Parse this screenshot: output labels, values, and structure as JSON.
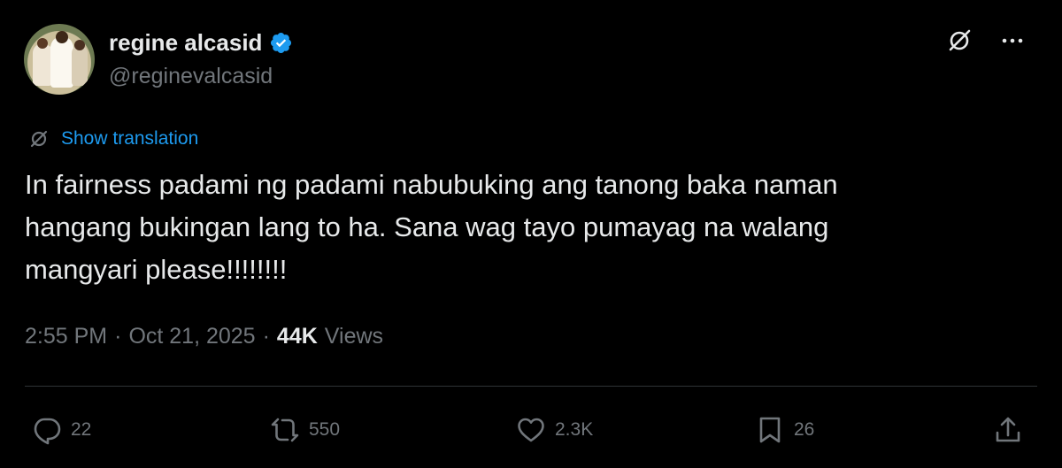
{
  "user": {
    "display_name": "regine alcasid",
    "handle": "@reginevalcasid",
    "verified": true
  },
  "translate": {
    "label": "Show translation"
  },
  "tweet": {
    "lines": [
      "In fairness padami ng padami nabubuking ang tanong baka naman",
      "hangang bukingan lang to ha. Sana wag tayo pumayag na walang",
      "mangyari please!!!!!!!!"
    ]
  },
  "meta": {
    "time": "2:55 PM",
    "separator": "·",
    "date": "Oct 21, 2025",
    "views_count": "44K",
    "views_label": "Views"
  },
  "actions": {
    "replies": "22",
    "reposts": "550",
    "likes": "2.3K",
    "bookmarks": "26"
  },
  "colors": {
    "background": "#000000",
    "text": "#e7e9ea",
    "muted": "#71767b",
    "link": "#1d9bf0",
    "divider": "#2f3336"
  },
  "icons": {
    "verified": "verified-badge-icon",
    "grok": "grok-icon",
    "more": "more-icon",
    "translate": "translate-icon",
    "reply": "reply-icon",
    "repost": "repost-icon",
    "like": "like-icon",
    "bookmark": "bookmark-icon",
    "share": "share-icon"
  }
}
